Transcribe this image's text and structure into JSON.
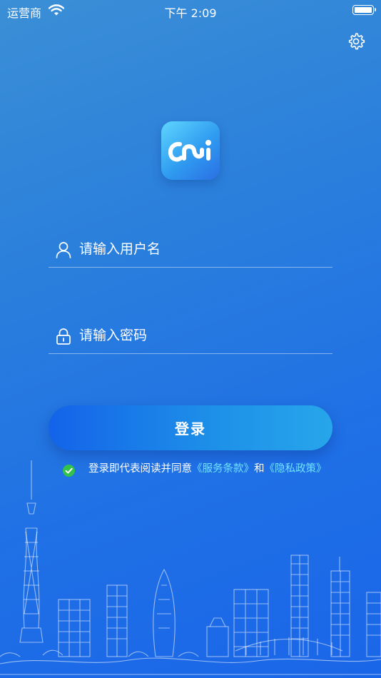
{
  "status_bar": {
    "carrier": "运营商",
    "time": "下午 2:09"
  },
  "icons": {
    "wifi": "wifi-icon",
    "battery": "battery-icon",
    "settings": "gear-icon",
    "username": "user-icon",
    "password": "lock-icon",
    "agree": "checkmark-icon"
  },
  "logo": {
    "text": "CNi"
  },
  "form": {
    "username_placeholder": "请输入用户名",
    "password_placeholder": "请输入密码",
    "login_label": "登录"
  },
  "agreement": {
    "prefix": "登录即代表阅读并同意",
    "service_link": "《服务条款》",
    "joiner": "和",
    "privacy_link": "《隐私政策》"
  },
  "colors": {
    "background_top": "#3b8fd6",
    "background_bottom": "#1a66e8",
    "link": "#6fe4ff",
    "check": "#33c24a"
  }
}
